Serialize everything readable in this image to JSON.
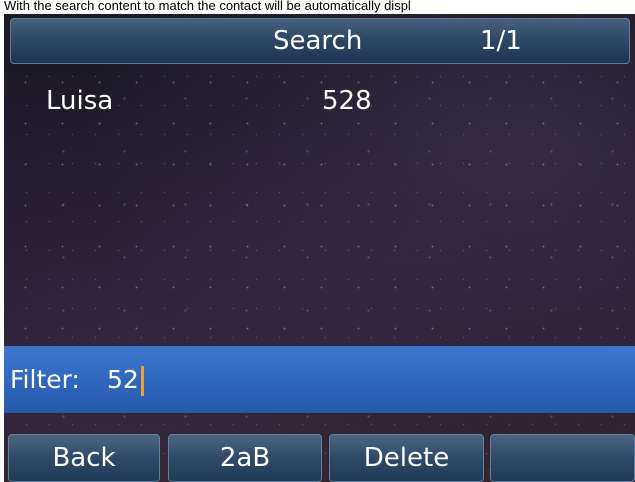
{
  "caption": "With the search content to match the contact will be automatically displ",
  "header": {
    "title": "Search",
    "page_indicator": "1/1"
  },
  "results": [
    {
      "name": "Luisa",
      "number": "528"
    }
  ],
  "filter": {
    "label": "Filter:",
    "value": "52"
  },
  "softkeys": [
    {
      "label": "Back"
    },
    {
      "label": "2aB"
    },
    {
      "label": "Delete"
    },
    {
      "label": ""
    }
  ],
  "colors": {
    "filter_bar": "#2f66bd",
    "caret": "#f0a030",
    "softkey": "#2f4a69",
    "text": "#ffffff"
  }
}
